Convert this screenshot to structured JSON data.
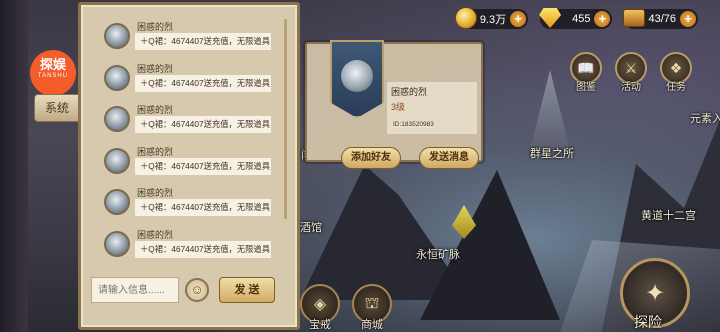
{
  "resources": [
    {
      "icon": "gold-coin-icon",
      "value": "9.3万"
    },
    {
      "icon": "diamond-icon",
      "value": "455"
    },
    {
      "icon": "stamina-chest-icon",
      "value": "43/76"
    }
  ],
  "logo": {
    "text": "探娱",
    "sub": "TANSHU"
  },
  "system_tab": "系统",
  "chat": {
    "messages": [
      {
        "name": "困惑的烈",
        "text": "＋Q裙：4674407送充值，无限道具"
      },
      {
        "name": "困惑的烈",
        "text": "＋Q裙：4674407送充值，无限道具"
      },
      {
        "name": "困惑的烈",
        "text": "＋Q裙：4674407送充值，无限道具"
      },
      {
        "name": "困惑的烈",
        "text": "＋Q裙：4674407送充值，无限道具"
      },
      {
        "name": "困惑的烈",
        "text": "＋Q裙：4674407送充值，无限道具"
      },
      {
        "name": "困惑的烈",
        "text": "＋Q裙：4674407送充值，无限道具"
      }
    ],
    "input_placeholder": "请输入信息......",
    "send_label": "发 送"
  },
  "profile": {
    "name": "困惑的烈",
    "level": "3级",
    "id": "ID:183520983",
    "add_friend": "添加好友",
    "send_message": "发送消息"
  },
  "side_menu": [
    {
      "label": "图鉴",
      "icon": "book-icon"
    },
    {
      "label": "活动",
      "icon": "swords-icon"
    },
    {
      "label": "任务",
      "icon": "quest-icon"
    }
  ],
  "map_labels": {
    "star_place": "群星之所",
    "zodiac": "黄道十二宫",
    "mine": "永恒矿脉",
    "tavern": "酒馆",
    "elements": "元素入",
    "left_cut": "闯"
  },
  "bottom_nav": [
    {
      "label": "宝戒",
      "icon": "ring-icon"
    },
    {
      "label": "商城",
      "icon": "shop-icon"
    }
  ],
  "explore": "探险"
}
